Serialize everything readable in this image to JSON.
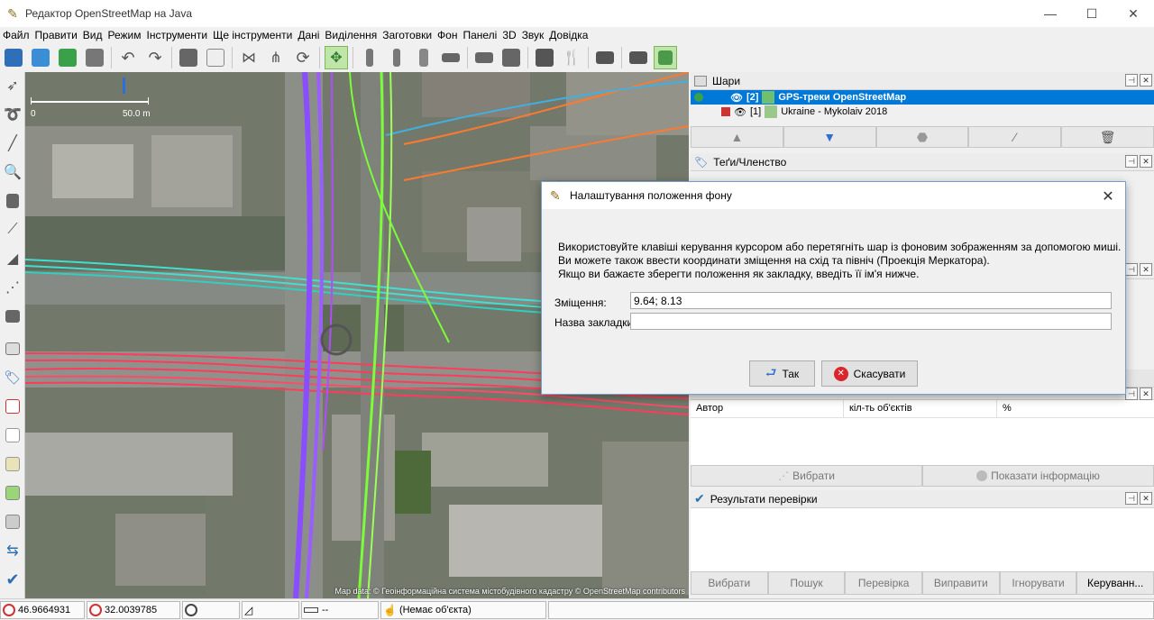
{
  "window": {
    "title": "Редактор OpenStreetMap на Java",
    "minimize_glyph": "—",
    "maximize_glyph": "☐",
    "close_glyph": "✕",
    "app_icon": "josm-icon"
  },
  "menubar": {
    "items": [
      "Файл",
      "Правити",
      "Вид",
      "Режим",
      "Інструменти",
      "Ще інструменти",
      "Дані",
      "Виділення",
      "Заготовки",
      "Фон",
      "Панелі",
      "3D",
      "Звук",
      "Довідка"
    ]
  },
  "toolbar": {
    "icons": [
      "open-icon",
      "upload-icon",
      "download-icon",
      "save-icon",
      "undo-icon",
      "redo-icon",
      "preferences-icon",
      "paste-tags-icon",
      "combine-way-icon",
      "split-way-icon",
      "refresh-icon",
      "imagery-offset-icon",
      "building-icon",
      "door-icon",
      "road-icon",
      "bus-stop-icon",
      "parking-icon",
      "info-icon",
      "restaurant-icon",
      "castle-icon",
      "factory-icon",
      "validator-icon"
    ]
  },
  "lefttoolbar": {
    "icons": [
      "select-icon",
      "lasso-icon",
      "draw-icon",
      "zoom-icon",
      "delete-icon",
      "improve-way-icon",
      "parallel-icon",
      "extrude-icon",
      "building-tool-icon",
      "layers-toggle-icon",
      "tags-toggle-icon",
      "relations-toggle-icon",
      "selection-list-icon",
      "history-icon",
      "filter-icon",
      "conflict-icon",
      "notes-icon",
      "validation-toggle-icon"
    ]
  },
  "map": {
    "scale_start": "0",
    "scale_end": "50.0 m",
    "attribution": "Map data: © Геоінформаційна система містобудівного кадастру © OpenStreetMap contributors"
  },
  "layers_panel": {
    "title": "Шари",
    "layers": [
      {
        "index": "[2]",
        "name": "GPS-треки OpenStreetMap",
        "selected": true
      },
      {
        "index": "[1]",
        "name": "Ukraine - Mykolaiv 2018",
        "selected": false
      }
    ],
    "buttons": [
      "move-up-icon",
      "move-down-icon",
      "merge-icon",
      "properties-icon",
      "delete-layer-icon"
    ]
  },
  "tags_panel": {
    "title": "Теґи/Членство"
  },
  "authors_table": {
    "headers": [
      "Автор",
      "кіл-ть об'єктів",
      "%"
    ],
    "buttons": [
      "Вибрати",
      "Показати інформацію"
    ]
  },
  "validation_panel": {
    "title": "Результати перевірки",
    "buttons": [
      "Вибрати",
      "Пошук",
      "Перевірка",
      "Виправити",
      "Ігнорувати",
      "Керуванн..."
    ]
  },
  "dialog": {
    "title": "Налаштування положення фону",
    "message_lines": [
      "Використовуйте клавіші керування курсором або перетягніть шар із фоновим зображенням за допомогою миші.",
      "Ви можете також ввести координати зміщення на схід та північ (Проекція Меркатора).",
      "Якщо ви бажаєте зберегти положення як закладку, введіть її ім'я нижче."
    ],
    "offset_label": "Зміщення:",
    "offset_value": "9.64; 8.13",
    "bookmark_label": "Назва закладки:",
    "bookmark_value": "",
    "ok_label": "Так",
    "cancel_label": "Скасувати"
  },
  "statusbar": {
    "lat": "46.9664931",
    "lon": "32.0039785",
    "heading": "",
    "angle": "",
    "length": "--",
    "selection": "(Немає об'єкта)"
  },
  "colors": {
    "selection_blue": "#0078d7",
    "gps_purple": "#8a4dff",
    "gps_red": "#ff3b5c",
    "gps_cyan": "#3fe0d0",
    "gps_green": "#7cfc3a"
  }
}
